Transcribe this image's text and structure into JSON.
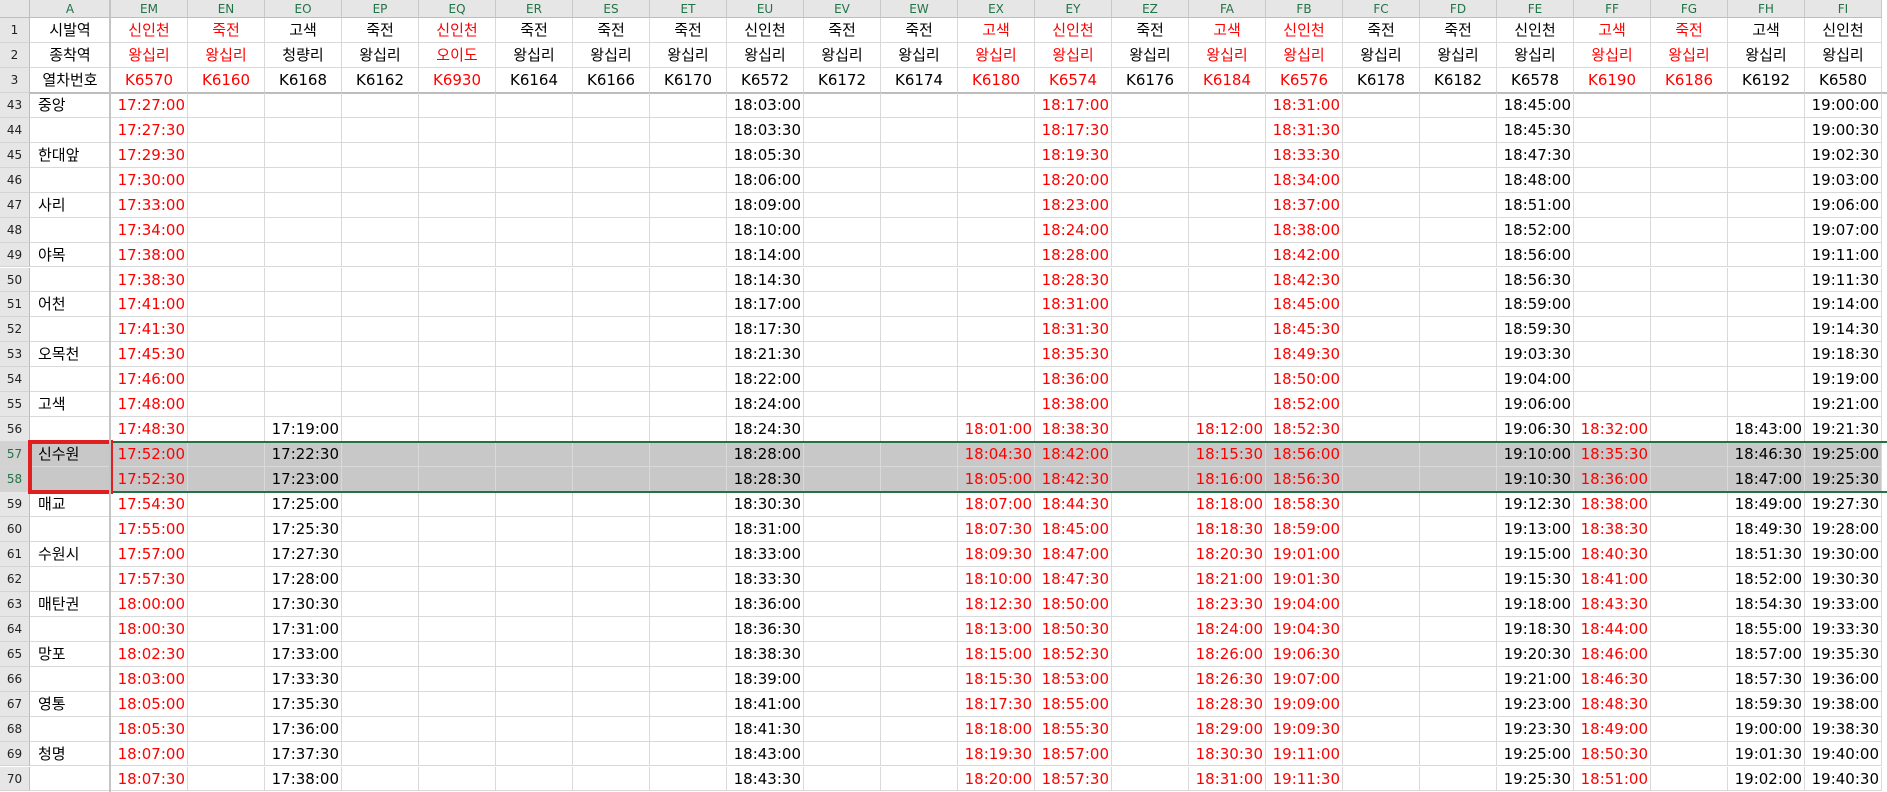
{
  "column_letters": [
    "A",
    "EM",
    "EN",
    "EO",
    "EP",
    "EQ",
    "ER",
    "ES",
    "ET",
    "EU",
    "EV",
    "EW",
    "EX",
    "EY",
    "EZ",
    "FA",
    "FB",
    "FC",
    "FD",
    "FE",
    "FF",
    "FG",
    "FH",
    "FI"
  ],
  "column_colors": {
    "EM": "red",
    "EN": "red",
    "EQ": "red",
    "EX": "red",
    "EY": "red",
    "FA": "red",
    "FB": "red",
    "FF": "red",
    "FG": "red"
  },
  "header_rows": [
    {
      "num": "1",
      "label": "시발역",
      "values": [
        "신인천",
        "죽전",
        "고색",
        "죽전",
        "신인천",
        "죽전",
        "죽전",
        "죽전",
        "신인천",
        "죽전",
        "죽전",
        "고색",
        "신인천",
        "죽전",
        "고색",
        "신인천",
        "죽전",
        "죽전",
        "신인천",
        "고색",
        "죽전",
        "고색",
        "신인천"
      ]
    },
    {
      "num": "2",
      "label": "종착역",
      "values": [
        "왕십리",
        "왕십리",
        "청량리",
        "왕십리",
        "오이도",
        "왕십리",
        "왕십리",
        "왕십리",
        "왕십리",
        "왕십리",
        "왕십리",
        "왕십리",
        "왕십리",
        "왕십리",
        "왕십리",
        "왕십리",
        "왕십리",
        "왕십리",
        "왕십리",
        "왕십리",
        "왕십리",
        "왕십리",
        "왕십리"
      ]
    },
    {
      "num": "3",
      "label": "열차번호",
      "values": [
        "K6570",
        "K6160",
        "K6168",
        "K6162",
        "K6930",
        "K6164",
        "K6166",
        "K6170",
        "K6572",
        "K6172",
        "K6174",
        "K6180",
        "K6574",
        "K6176",
        "K6184",
        "K6576",
        "K6178",
        "K6182",
        "K6578",
        "K6190",
        "K6186",
        "K6192",
        "K6580"
      ]
    }
  ],
  "data_rows": [
    {
      "num": "43",
      "label": "중앙",
      "values": [
        "17:27:00",
        "",
        "",
        "",
        "",
        "",
        "",
        "",
        "18:03:00",
        "",
        "",
        "",
        "18:17:00",
        "",
        "",
        "18:31:00",
        "",
        "",
        "18:45:00",
        "",
        "",
        "",
        "19:00:00"
      ]
    },
    {
      "num": "44",
      "label": "",
      "values": [
        "17:27:30",
        "",
        "",
        "",
        "",
        "",
        "",
        "",
        "18:03:30",
        "",
        "",
        "",
        "18:17:30",
        "",
        "",
        "18:31:30",
        "",
        "",
        "18:45:30",
        "",
        "",
        "",
        "19:00:30"
      ]
    },
    {
      "num": "45",
      "label": "한대앞",
      "values": [
        "17:29:30",
        "",
        "",
        "",
        "",
        "",
        "",
        "",
        "18:05:30",
        "",
        "",
        "",
        "18:19:30",
        "",
        "",
        "18:33:30",
        "",
        "",
        "18:47:30",
        "",
        "",
        "",
        "19:02:30"
      ]
    },
    {
      "num": "46",
      "label": "",
      "values": [
        "17:30:00",
        "",
        "",
        "",
        "",
        "",
        "",
        "",
        "18:06:00",
        "",
        "",
        "",
        "18:20:00",
        "",
        "",
        "18:34:00",
        "",
        "",
        "18:48:00",
        "",
        "",
        "",
        "19:03:00"
      ]
    },
    {
      "num": "47",
      "label": "사리",
      "values": [
        "17:33:00",
        "",
        "",
        "",
        "",
        "",
        "",
        "",
        "18:09:00",
        "",
        "",
        "",
        "18:23:00",
        "",
        "",
        "18:37:00",
        "",
        "",
        "18:51:00",
        "",
        "",
        "",
        "19:06:00"
      ]
    },
    {
      "num": "48",
      "label": "",
      "values": [
        "17:34:00",
        "",
        "",
        "",
        "",
        "",
        "",
        "",
        "18:10:00",
        "",
        "",
        "",
        "18:24:00",
        "",
        "",
        "18:38:00",
        "",
        "",
        "18:52:00",
        "",
        "",
        "",
        "19:07:00"
      ]
    },
    {
      "num": "49",
      "label": "야목",
      "values": [
        "17:38:00",
        "",
        "",
        "",
        "",
        "",
        "",
        "",
        "18:14:00",
        "",
        "",
        "",
        "18:28:00",
        "",
        "",
        "18:42:00",
        "",
        "",
        "18:56:00",
        "",
        "",
        "",
        "19:11:00"
      ]
    },
    {
      "num": "50",
      "label": "",
      "values": [
        "17:38:30",
        "",
        "",
        "",
        "",
        "",
        "",
        "",
        "18:14:30",
        "",
        "",
        "",
        "18:28:30",
        "",
        "",
        "18:42:30",
        "",
        "",
        "18:56:30",
        "",
        "",
        "",
        "19:11:30"
      ]
    },
    {
      "num": "51",
      "label": "어천",
      "values": [
        "17:41:00",
        "",
        "",
        "",
        "",
        "",
        "",
        "",
        "18:17:00",
        "",
        "",
        "",
        "18:31:00",
        "",
        "",
        "18:45:00",
        "",
        "",
        "18:59:00",
        "",
        "",
        "",
        "19:14:00"
      ]
    },
    {
      "num": "52",
      "label": "",
      "values": [
        "17:41:30",
        "",
        "",
        "",
        "",
        "",
        "",
        "",
        "18:17:30",
        "",
        "",
        "",
        "18:31:30",
        "",
        "",
        "18:45:30",
        "",
        "",
        "18:59:30",
        "",
        "",
        "",
        "19:14:30"
      ]
    },
    {
      "num": "53",
      "label": "오목천",
      "values": [
        "17:45:30",
        "",
        "",
        "",
        "",
        "",
        "",
        "",
        "18:21:30",
        "",
        "",
        "",
        "18:35:30",
        "",
        "",
        "18:49:30",
        "",
        "",
        "19:03:30",
        "",
        "",
        "",
        "19:18:30"
      ]
    },
    {
      "num": "54",
      "label": "",
      "values": [
        "17:46:00",
        "",
        "",
        "",
        "",
        "",
        "",
        "",
        "18:22:00",
        "",
        "",
        "",
        "18:36:00",
        "",
        "",
        "18:50:00",
        "",
        "",
        "19:04:00",
        "",
        "",
        "",
        "19:19:00"
      ]
    },
    {
      "num": "55",
      "label": "고색",
      "values": [
        "17:48:00",
        "",
        "",
        "",
        "",
        "",
        "",
        "",
        "18:24:00",
        "",
        "",
        "",
        "18:38:00",
        "",
        "",
        "18:52:00",
        "",
        "",
        "19:06:00",
        "",
        "",
        "",
        "19:21:00"
      ]
    },
    {
      "num": "56",
      "label": "",
      "values": [
        "17:48:30",
        "",
        "17:19:00",
        "",
        "",
        "",
        "",
        "",
        "18:24:30",
        "",
        "",
        "18:01:00",
        "18:38:30",
        "",
        "18:12:00",
        "18:52:30",
        "",
        "",
        "19:06:30",
        "18:32:00",
        "",
        "18:43:00",
        "19:21:30"
      ]
    },
    {
      "num": "57",
      "label": "신수원",
      "selected": true,
      "values": [
        "17:52:00",
        "",
        "17:22:30",
        "",
        "",
        "",
        "",
        "",
        "18:28:00",
        "",
        "",
        "18:04:30",
        "18:42:00",
        "",
        "18:15:30",
        "18:56:00",
        "",
        "",
        "19:10:00",
        "18:35:30",
        "",
        "18:46:30",
        "19:25:00"
      ]
    },
    {
      "num": "58",
      "label": "",
      "selected": true,
      "values": [
        "17:52:30",
        "",
        "17:23:00",
        "",
        "",
        "",
        "",
        "",
        "18:28:30",
        "",
        "",
        "18:05:00",
        "18:42:30",
        "",
        "18:16:00",
        "18:56:30",
        "",
        "",
        "19:10:30",
        "18:36:00",
        "",
        "18:47:00",
        "19:25:30"
      ]
    },
    {
      "num": "59",
      "label": "매교",
      "values": [
        "17:54:30",
        "",
        "17:25:00",
        "",
        "",
        "",
        "",
        "",
        "18:30:30",
        "",
        "",
        "18:07:00",
        "18:44:30",
        "",
        "18:18:00",
        "18:58:30",
        "",
        "",
        "19:12:30",
        "18:38:00",
        "",
        "18:49:00",
        "19:27:30"
      ]
    },
    {
      "num": "60",
      "label": "",
      "values": [
        "17:55:00",
        "",
        "17:25:30",
        "",
        "",
        "",
        "",
        "",
        "18:31:00",
        "",
        "",
        "18:07:30",
        "18:45:00",
        "",
        "18:18:30",
        "18:59:00",
        "",
        "",
        "19:13:00",
        "18:38:30",
        "",
        "18:49:30",
        "19:28:00"
      ]
    },
    {
      "num": "61",
      "label": "수원시",
      "values": [
        "17:57:00",
        "",
        "17:27:30",
        "",
        "",
        "",
        "",
        "",
        "18:33:00",
        "",
        "",
        "18:09:30",
        "18:47:00",
        "",
        "18:20:30",
        "19:01:00",
        "",
        "",
        "19:15:00",
        "18:40:30",
        "",
        "18:51:30",
        "19:30:00"
      ]
    },
    {
      "num": "62",
      "label": "",
      "values": [
        "17:57:30",
        "",
        "17:28:00",
        "",
        "",
        "",
        "",
        "",
        "18:33:30",
        "",
        "",
        "18:10:00",
        "18:47:30",
        "",
        "18:21:00",
        "19:01:30",
        "",
        "",
        "19:15:30",
        "18:41:00",
        "",
        "18:52:00",
        "19:30:30"
      ]
    },
    {
      "num": "63",
      "label": "매탄권",
      "values": [
        "18:00:00",
        "",
        "17:30:30",
        "",
        "",
        "",
        "",
        "",
        "18:36:00",
        "",
        "",
        "18:12:30",
        "18:50:00",
        "",
        "18:23:30",
        "19:04:00",
        "",
        "",
        "19:18:00",
        "18:43:30",
        "",
        "18:54:30",
        "19:33:00"
      ]
    },
    {
      "num": "64",
      "label": "",
      "values": [
        "18:00:30",
        "",
        "17:31:00",
        "",
        "",
        "",
        "",
        "",
        "18:36:30",
        "",
        "",
        "18:13:00",
        "18:50:30",
        "",
        "18:24:00",
        "19:04:30",
        "",
        "",
        "19:18:30",
        "18:44:00",
        "",
        "18:55:00",
        "19:33:30"
      ]
    },
    {
      "num": "65",
      "label": "망포",
      "values": [
        "18:02:30",
        "",
        "17:33:00",
        "",
        "",
        "",
        "",
        "",
        "18:38:30",
        "",
        "",
        "18:15:00",
        "18:52:30",
        "",
        "18:26:00",
        "19:06:30",
        "",
        "",
        "19:20:30",
        "18:46:00",
        "",
        "18:57:00",
        "19:35:30"
      ]
    },
    {
      "num": "66",
      "label": "",
      "values": [
        "18:03:00",
        "",
        "17:33:30",
        "",
        "",
        "",
        "",
        "",
        "18:39:00",
        "",
        "",
        "18:15:30",
        "18:53:00",
        "",
        "18:26:30",
        "19:07:00",
        "",
        "",
        "19:21:00",
        "18:46:30",
        "",
        "18:57:30",
        "19:36:00"
      ]
    },
    {
      "num": "67",
      "label": "영통",
      "values": [
        "18:05:00",
        "",
        "17:35:30",
        "",
        "",
        "",
        "",
        "",
        "18:41:00",
        "",
        "",
        "18:17:30",
        "18:55:00",
        "",
        "18:28:30",
        "19:09:00",
        "",
        "",
        "19:23:00",
        "18:48:30",
        "",
        "18:59:30",
        "19:38:00"
      ]
    },
    {
      "num": "68",
      "label": "",
      "values": [
        "18:05:30",
        "",
        "17:36:00",
        "",
        "",
        "",
        "",
        "",
        "18:41:30",
        "",
        "",
        "18:18:00",
        "18:55:30",
        "",
        "18:29:00",
        "19:09:30",
        "",
        "",
        "19:23:30",
        "18:49:00",
        "",
        "19:00:00",
        "19:38:30"
      ]
    },
    {
      "num": "69",
      "label": "청명",
      "values": [
        "18:07:00",
        "",
        "17:37:30",
        "",
        "",
        "",
        "",
        "",
        "18:43:00",
        "",
        "",
        "18:19:30",
        "18:57:00",
        "",
        "18:30:30",
        "19:11:00",
        "",
        "",
        "19:25:00",
        "18:50:30",
        "",
        "19:01:30",
        "19:40:00"
      ]
    },
    {
      "num": "70",
      "label": "",
      "values": [
        "18:07:30",
        "",
        "17:38:00",
        "",
        "",
        "",
        "",
        "",
        "18:43:30",
        "",
        "",
        "18:20:00",
        "18:57:30",
        "",
        "18:31:00",
        "19:11:30",
        "",
        "",
        "19:25:30",
        "18:51:00",
        "",
        "19:02:00",
        "19:40:30"
      ]
    }
  ]
}
